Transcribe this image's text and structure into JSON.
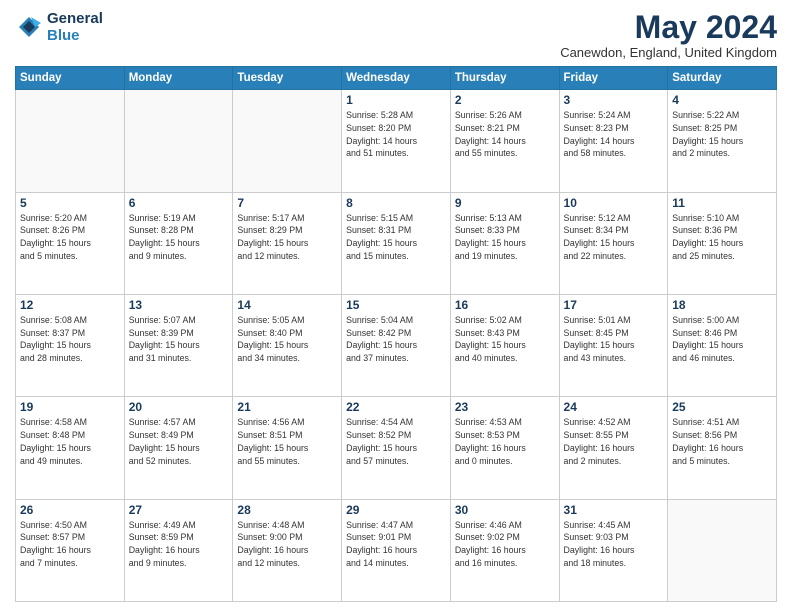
{
  "header": {
    "logo_line1": "General",
    "logo_line2": "Blue",
    "month_title": "May 2024",
    "subtitle": "Canewdon, England, United Kingdom"
  },
  "weekdays": [
    "Sunday",
    "Monday",
    "Tuesday",
    "Wednesday",
    "Thursday",
    "Friday",
    "Saturday"
  ],
  "weeks": [
    [
      {
        "day": "",
        "info": ""
      },
      {
        "day": "",
        "info": ""
      },
      {
        "day": "",
        "info": ""
      },
      {
        "day": "1",
        "info": "Sunrise: 5:28 AM\nSunset: 8:20 PM\nDaylight: 14 hours\nand 51 minutes."
      },
      {
        "day": "2",
        "info": "Sunrise: 5:26 AM\nSunset: 8:21 PM\nDaylight: 14 hours\nand 55 minutes."
      },
      {
        "day": "3",
        "info": "Sunrise: 5:24 AM\nSunset: 8:23 PM\nDaylight: 14 hours\nand 58 minutes."
      },
      {
        "day": "4",
        "info": "Sunrise: 5:22 AM\nSunset: 8:25 PM\nDaylight: 15 hours\nand 2 minutes."
      }
    ],
    [
      {
        "day": "5",
        "info": "Sunrise: 5:20 AM\nSunset: 8:26 PM\nDaylight: 15 hours\nand 5 minutes."
      },
      {
        "day": "6",
        "info": "Sunrise: 5:19 AM\nSunset: 8:28 PM\nDaylight: 15 hours\nand 9 minutes."
      },
      {
        "day": "7",
        "info": "Sunrise: 5:17 AM\nSunset: 8:29 PM\nDaylight: 15 hours\nand 12 minutes."
      },
      {
        "day": "8",
        "info": "Sunrise: 5:15 AM\nSunset: 8:31 PM\nDaylight: 15 hours\nand 15 minutes."
      },
      {
        "day": "9",
        "info": "Sunrise: 5:13 AM\nSunset: 8:33 PM\nDaylight: 15 hours\nand 19 minutes."
      },
      {
        "day": "10",
        "info": "Sunrise: 5:12 AM\nSunset: 8:34 PM\nDaylight: 15 hours\nand 22 minutes."
      },
      {
        "day": "11",
        "info": "Sunrise: 5:10 AM\nSunset: 8:36 PM\nDaylight: 15 hours\nand 25 minutes."
      }
    ],
    [
      {
        "day": "12",
        "info": "Sunrise: 5:08 AM\nSunset: 8:37 PM\nDaylight: 15 hours\nand 28 minutes."
      },
      {
        "day": "13",
        "info": "Sunrise: 5:07 AM\nSunset: 8:39 PM\nDaylight: 15 hours\nand 31 minutes."
      },
      {
        "day": "14",
        "info": "Sunrise: 5:05 AM\nSunset: 8:40 PM\nDaylight: 15 hours\nand 34 minutes."
      },
      {
        "day": "15",
        "info": "Sunrise: 5:04 AM\nSunset: 8:42 PM\nDaylight: 15 hours\nand 37 minutes."
      },
      {
        "day": "16",
        "info": "Sunrise: 5:02 AM\nSunset: 8:43 PM\nDaylight: 15 hours\nand 40 minutes."
      },
      {
        "day": "17",
        "info": "Sunrise: 5:01 AM\nSunset: 8:45 PM\nDaylight: 15 hours\nand 43 minutes."
      },
      {
        "day": "18",
        "info": "Sunrise: 5:00 AM\nSunset: 8:46 PM\nDaylight: 15 hours\nand 46 minutes."
      }
    ],
    [
      {
        "day": "19",
        "info": "Sunrise: 4:58 AM\nSunset: 8:48 PM\nDaylight: 15 hours\nand 49 minutes."
      },
      {
        "day": "20",
        "info": "Sunrise: 4:57 AM\nSunset: 8:49 PM\nDaylight: 15 hours\nand 52 minutes."
      },
      {
        "day": "21",
        "info": "Sunrise: 4:56 AM\nSunset: 8:51 PM\nDaylight: 15 hours\nand 55 minutes."
      },
      {
        "day": "22",
        "info": "Sunrise: 4:54 AM\nSunset: 8:52 PM\nDaylight: 15 hours\nand 57 minutes."
      },
      {
        "day": "23",
        "info": "Sunrise: 4:53 AM\nSunset: 8:53 PM\nDaylight: 16 hours\nand 0 minutes."
      },
      {
        "day": "24",
        "info": "Sunrise: 4:52 AM\nSunset: 8:55 PM\nDaylight: 16 hours\nand 2 minutes."
      },
      {
        "day": "25",
        "info": "Sunrise: 4:51 AM\nSunset: 8:56 PM\nDaylight: 16 hours\nand 5 minutes."
      }
    ],
    [
      {
        "day": "26",
        "info": "Sunrise: 4:50 AM\nSunset: 8:57 PM\nDaylight: 16 hours\nand 7 minutes."
      },
      {
        "day": "27",
        "info": "Sunrise: 4:49 AM\nSunset: 8:59 PM\nDaylight: 16 hours\nand 9 minutes."
      },
      {
        "day": "28",
        "info": "Sunrise: 4:48 AM\nSunset: 9:00 PM\nDaylight: 16 hours\nand 12 minutes."
      },
      {
        "day": "29",
        "info": "Sunrise: 4:47 AM\nSunset: 9:01 PM\nDaylight: 16 hours\nand 14 minutes."
      },
      {
        "day": "30",
        "info": "Sunrise: 4:46 AM\nSunset: 9:02 PM\nDaylight: 16 hours\nand 16 minutes."
      },
      {
        "day": "31",
        "info": "Sunrise: 4:45 AM\nSunset: 9:03 PM\nDaylight: 16 hours\nand 18 minutes."
      },
      {
        "day": "",
        "info": ""
      }
    ]
  ]
}
